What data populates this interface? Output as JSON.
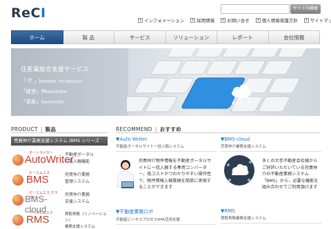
{
  "header": {
    "logo_text": "ReC",
    "logo_accent": "I",
    "search_placeholder": "",
    "search_button": "サイト内検索",
    "util_links": [
      "インフォメーション",
      "採用情報",
      "お問い合せ",
      "個人情報保護方針",
      "サイトマップ"
    ]
  },
  "nav": {
    "items": [
      "ホーム",
      "製 品",
      "サービス",
      "ソリューション",
      "レポート",
      "会社情報"
    ],
    "active_index": 0
  },
  "hero": {
    "title": "住産業総合支援サービス",
    "line1_prefix": "「 IT 」",
    "line1_text": "Internet technology",
    "line2_prefix": "「経営」",
    "line2_text": "Management",
    "line3_prefix": "「革新」",
    "line3_text": "Innovation"
  },
  "product": {
    "heading_en": "PRODUCT",
    "heading_jp": "製品",
    "banner": "売買仲介業務支援システム /BMS シリーズ",
    "items": [
      {
        "ruby": "オートライター",
        "name": "AutoWriter",
        "desc": "不動産ポータル\n一括入稿機能"
      },
      {
        "ruby": "ビーエムエス",
        "name": "BMS",
        "desc": "売買仲介業務\n管理システム"
      },
      {
        "ruby": "ビーエムエス クラウド",
        "name": "BMS-cloud",
        "desc": "売買仲介業務\n支援システム"
      },
      {
        "ruby": "アールエムエス",
        "name": "RMS",
        "desc": "買取再販（リノベーション）\n業務支援システム"
      }
    ]
  },
  "recommend": {
    "heading_en": "RECOMMEND",
    "heading_jp": "おすすめ",
    "cards": [
      {
        "title": "▼Auto Writer",
        "sub": "不動産ポータルサイト一括入稿システム",
        "text": "売買仲介物件情報を不動産ポータルサイトに一括入稿する専用コンバーター。低コストかつわかりやすい操作性で、物件情報入稿業務を簡単に実現することができます"
      },
      {
        "title": "▼BMS-cloud",
        "sub": "売買仲介業務支援システム",
        "text": "多くの大手不動産会社様からご好評いただいている売買仲介の不動産業務システム「BMS」から、必要な機能を組み合わせてご利用頂けます"
      },
      {
        "title": "▼不動産業務ロボ",
        "sub": "不動産ビジネスプロセスRPA活用支援"
      },
      {
        "title": "▼RMS",
        "sub": "買取再販業務支援システム"
      }
    ]
  }
}
